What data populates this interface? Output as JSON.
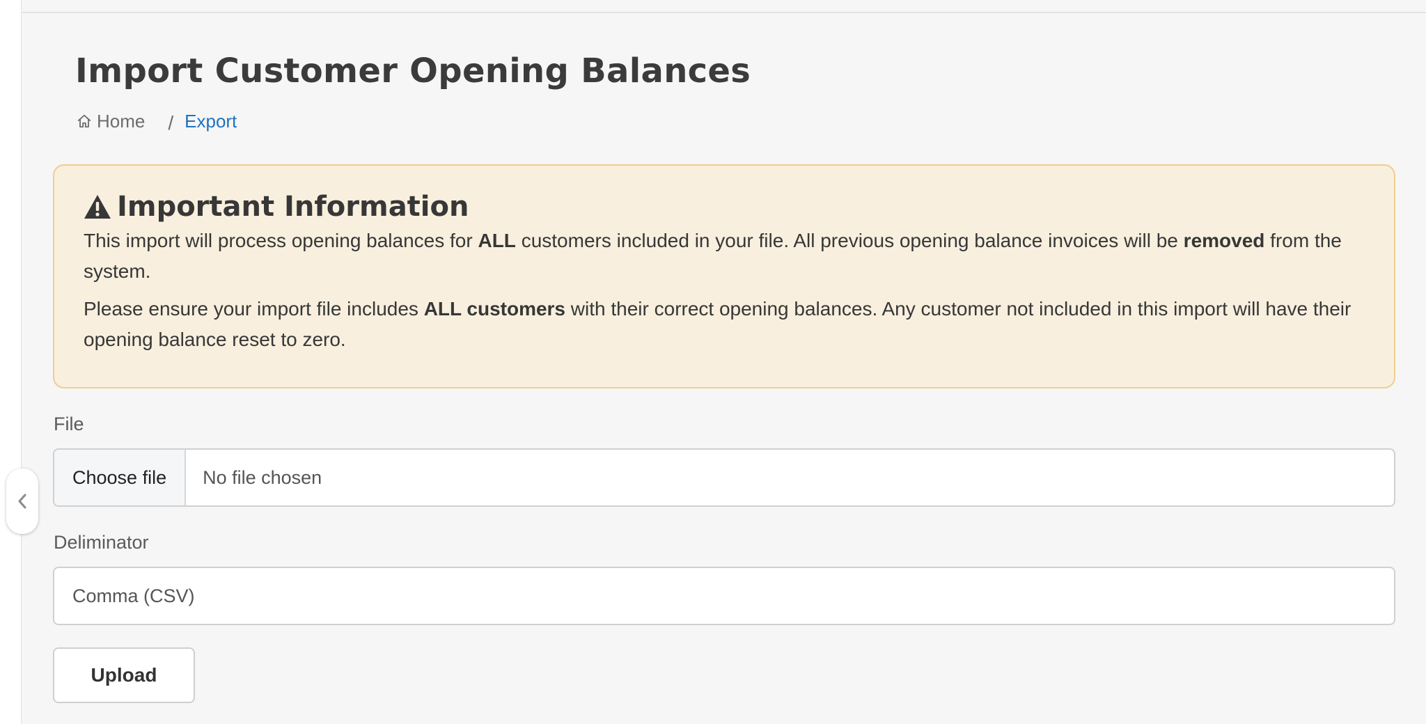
{
  "page": {
    "title": "Import Customer Opening Balances"
  },
  "breadcrumb": {
    "home": "Home",
    "separator": "/",
    "current": "Export"
  },
  "alert": {
    "title": "Important Information",
    "p1": {
      "a": "This import will process opening balances for ",
      "b": "ALL",
      "c": " customers included in your file. All previous opening balance invoices will be ",
      "d": "removed",
      "e": " from the system."
    },
    "p2": {
      "a": "Please ensure your import file includes ",
      "b": "ALL customers",
      "c": " with their correct opening balances. Any customer not included in this import will have their opening balance reset to zero."
    },
    "colors": {
      "background": "#f8efde",
      "border": "#f1cd90"
    }
  },
  "form": {
    "file_label": "File",
    "choose_file": "Choose file",
    "no_file": "No file chosen",
    "delimiter_label": "Deliminator",
    "delimiter_value": "Comma (CSV)",
    "upload": "Upload"
  },
  "icons": {
    "home": "home-icon",
    "warning": "warning-triangle-icon",
    "collapse": "chevron-left-icon"
  },
  "colors": {
    "link": "#1f72bf"
  }
}
